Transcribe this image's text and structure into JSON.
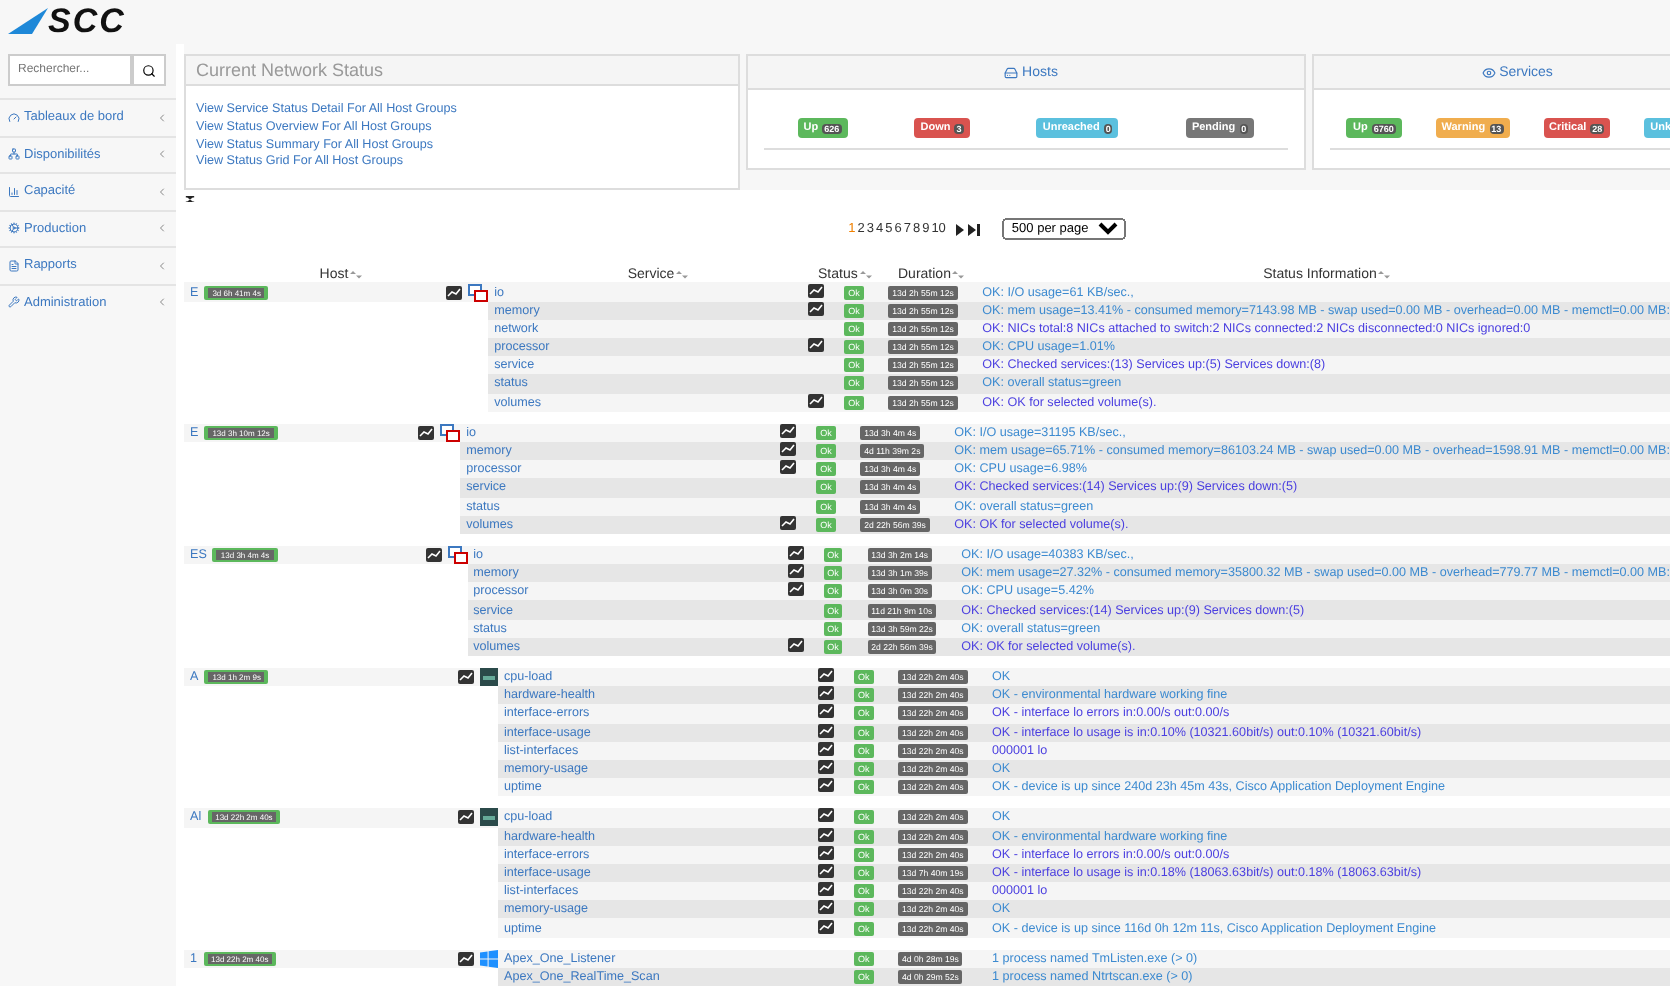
{
  "logo": {
    "text": "SCC"
  },
  "search": {
    "placeholder": "Rechercher..."
  },
  "sidebar": {
    "items": [
      {
        "label": "Tableaux de bord"
      },
      {
        "label": "Disponibilités"
      },
      {
        "label": "Capacité"
      },
      {
        "label": "Production"
      },
      {
        "label": "Rapports"
      },
      {
        "label": "Administration"
      }
    ]
  },
  "network_status": {
    "title": "Current Network Status",
    "links": [
      "View Service Status Detail For All Host Groups",
      "View Status Overview For All Host Groups",
      "View Status Summary For All Host Groups",
      "View Status Grid For All Host Groups"
    ]
  },
  "hosts": {
    "title": "Hosts",
    "badges": [
      {
        "label": "Up",
        "count": "626",
        "color": "#5cb85c"
      },
      {
        "label": "Down",
        "count": "3",
        "color": "#d9534f"
      },
      {
        "label": "Unreached",
        "count": "0",
        "color": "#5bc0de"
      },
      {
        "label": "Pending",
        "count": "0",
        "color": "#777777"
      }
    ]
  },
  "services": {
    "title": "Services",
    "badges": [
      {
        "label": "Up",
        "count": "6760",
        "color": "#5cb85c"
      },
      {
        "label": "Warning",
        "count": "13",
        "color": "#f0ad4e"
      },
      {
        "label": "Critical",
        "count": "28",
        "color": "#d9534f"
      },
      {
        "label": "Unk",
        "color": "#5bc0de"
      }
    ]
  },
  "pagination": {
    "pages": [
      {
        "label": "1",
        "selected": true
      },
      {
        "label": "2",
        "selected": false
      },
      {
        "label": "3",
        "selected": false
      },
      {
        "label": "4",
        "selected": false
      },
      {
        "label": "5",
        "selected": false
      },
      {
        "label": "6",
        "selected": false
      },
      {
        "label": "7",
        "selected": false
      },
      {
        "label": "8",
        "selected": false
      },
      {
        "label": "9",
        "selected": false
      },
      {
        "label": "10",
        "selected": false
      }
    ],
    "per_page": "500 per page"
  },
  "table": {
    "columns": [
      "Host",
      "Service",
      "Status",
      "Duration",
      "Status Information"
    ],
    "groups": [
      {
        "host": "E",
        "host_duration": "3d 6h 41m 4s",
        "kind": "vmware",
        "rows": [
          {
            "service": "io",
            "graph": true,
            "status": "Ok",
            "duration": "13d 2h 55m 12s",
            "info": "OK: I/O usage=61 KB/sec.,",
            "visited": false
          },
          {
            "service": "memory",
            "graph": true,
            "status": "Ok",
            "duration": "13d 2h 55m 12s",
            "info": "OK: mem usage=13.41% - consumed memory=7143.98 MB - swap used=0.00 MB - overhead=0.00 MB - memctl=0.00 MB:",
            "visited": false
          },
          {
            "service": "network",
            "graph": false,
            "status": "Ok",
            "duration": "13d 2h 55m 12s",
            "info": "OK: NICs total:8 NICs attached to switch:2 NICs connected:2 NICs disconnected:0 NICs ignored:0",
            "visited": true
          },
          {
            "service": "processor",
            "graph": true,
            "status": "Ok",
            "duration": "13d 2h 55m 12s",
            "info": "OK: CPU usage=1.01%",
            "visited": false
          },
          {
            "service": "service",
            "graph": false,
            "status": "Ok",
            "duration": "13d 2h 55m 12s",
            "info": "OK: Checked services:(13) Services up:(5) Services down:(8)",
            "visited": true
          },
          {
            "service": "status",
            "graph": false,
            "status": "Ok",
            "duration": "13d 2h 55m 12s",
            "info": "OK: overall status=green",
            "visited": false
          },
          {
            "service": "volumes",
            "graph": true,
            "status": "Ok",
            "duration": "13d 2h 55m 12s",
            "info": "OK: OK for selected volume(s).",
            "visited": true
          }
        ]
      },
      {
        "host": "E",
        "host_duration": "13d 3h 10m 12s",
        "kind": "vmware",
        "rows": [
          {
            "service": "io",
            "graph": true,
            "status": "Ok",
            "duration": "13d 3h 4m 4s",
            "info": "OK: I/O usage=31195 KB/sec.,",
            "visited": false
          },
          {
            "service": "memory",
            "graph": true,
            "status": "Ok",
            "duration": "4d 11h 39m 2s",
            "info": "OK: mem usage=65.71% - consumed memory=86103.24 MB - swap used=0.00 MB - overhead=1598.91 MB - memctl=0.00 MB:",
            "visited": false
          },
          {
            "service": "processor",
            "graph": true,
            "status": "Ok",
            "duration": "13d 3h 4m 4s",
            "info": "OK: CPU usage=6.98%",
            "visited": false
          },
          {
            "service": "service",
            "graph": false,
            "status": "Ok",
            "duration": "13d 3h 4m 4s",
            "info": "OK: Checked services:(14) Services up:(9) Services down:(5)",
            "visited": true
          },
          {
            "service": "status",
            "graph": false,
            "status": "Ok",
            "duration": "13d 3h 4m 4s",
            "info": "OK: overall status=green",
            "visited": false
          },
          {
            "service": "volumes",
            "graph": true,
            "status": "Ok",
            "duration": "2d 22h 56m 39s",
            "info": "OK: OK for selected volume(s).",
            "visited": true
          }
        ]
      },
      {
        "host": "ES",
        "host_duration": "13d 3h 4m 4s",
        "kind": "vmware",
        "rows": [
          {
            "service": "io",
            "graph": true,
            "status": "Ok",
            "duration": "13d 3h 2m 14s",
            "info": "OK: I/O usage=40383 KB/sec.,",
            "visited": false
          },
          {
            "service": "memory",
            "graph": true,
            "status": "Ok",
            "duration": "13d 3h 1m 39s",
            "info": "OK: mem usage=27.32% - consumed memory=35800.32 MB - swap used=0.00 MB - overhead=779.77 MB - memctl=0.00 MB:",
            "visited": false
          },
          {
            "service": "processor",
            "graph": true,
            "status": "Ok",
            "duration": "13d 3h 0m 30s",
            "info": "OK: CPU usage=5.42%",
            "visited": false
          },
          {
            "service": "service",
            "graph": false,
            "status": "Ok",
            "duration": "11d 21h 9m 10s",
            "info": "OK: Checked services:(14) Services up:(9) Services down:(5)",
            "visited": true
          },
          {
            "service": "status",
            "graph": false,
            "status": "Ok",
            "duration": "13d 3h 59m 22s",
            "info": "OK: overall status=green",
            "visited": false
          },
          {
            "service": "volumes",
            "graph": true,
            "status": "Ok",
            "duration": "2d 22h 56m 39s",
            "info": "OK: OK for selected volume(s).",
            "visited": true
          }
        ]
      },
      {
        "host": "A",
        "host_duration": "13d 1h 2m 9s",
        "kind": "cisco",
        "rows": [
          {
            "service": "cpu-load",
            "graph": true,
            "status": "Ok",
            "duration": "13d 22h 2m 40s",
            "info": "OK",
            "visited": false
          },
          {
            "service": "hardware-health",
            "graph": true,
            "status": "Ok",
            "duration": "13d 22h 2m 40s",
            "info": "OK - environmental hardware working fine",
            "visited": false
          },
          {
            "service": "interface-errors",
            "graph": true,
            "status": "Ok",
            "duration": "13d 22h 2m 40s",
            "info": "OK - interface lo errors in:0.00/s out:0.00/s",
            "visited": true
          },
          {
            "service": "interface-usage",
            "graph": true,
            "status": "Ok",
            "duration": "13d 22h 2m 40s",
            "info": "OK - interface lo usage is in:0.10% (10321.60bit/s) out:0.10% (10321.60bit/s)",
            "visited": true
          },
          {
            "service": "list-interfaces",
            "graph": true,
            "status": "Ok",
            "duration": "13d 22h 2m 40s",
            "info": "000001 lo",
            "visited": true
          },
          {
            "service": "memory-usage",
            "graph": true,
            "status": "Ok",
            "duration": "13d 22h 2m 40s",
            "info": "OK",
            "visited": false
          },
          {
            "service": "uptime",
            "graph": true,
            "status": "Ok",
            "duration": "13d 22h 2m 40s",
            "info": "OK - device is up since 240d 23h 45m 43s, Cisco Application Deployment Engine",
            "visited": false
          }
        ]
      },
      {
        "host": "Al",
        "host_duration": "13d 22h 2m 40s",
        "kind": "cisco",
        "rows": [
          {
            "service": "cpu-load",
            "graph": true,
            "status": "Ok",
            "duration": "13d 22h 2m 40s",
            "info": "OK",
            "visited": false
          },
          {
            "service": "hardware-health",
            "graph": true,
            "status": "Ok",
            "duration": "13d 22h 2m 40s",
            "info": "OK - environmental hardware working fine",
            "visited": false
          },
          {
            "service": "interface-errors",
            "graph": true,
            "status": "Ok",
            "duration": "13d 22h 2m 40s",
            "info": "OK - interface lo errors in:0.00/s out:0.00/s",
            "visited": true
          },
          {
            "service": "interface-usage",
            "graph": true,
            "status": "Ok",
            "duration": "13d 7h 40m 19s",
            "info": "OK - interface lo usage is in:0.18% (18063.63bit/s) out:0.18% (18063.63bit/s)",
            "visited": true
          },
          {
            "service": "list-interfaces",
            "graph": true,
            "status": "Ok",
            "duration": "13d 22h 2m 40s",
            "info": "000001 lo",
            "visited": true
          },
          {
            "service": "memory-usage",
            "graph": true,
            "status": "Ok",
            "duration": "13d 22h 2m 40s",
            "info": "OK",
            "visited": false
          },
          {
            "service": "uptime",
            "graph": true,
            "status": "Ok",
            "duration": "13d 22h 2m 40s",
            "info": "OK - device is up since 116d 0h 12m 11s, Cisco Application Deployment Engine",
            "visited": false
          }
        ]
      },
      {
        "host": "1",
        "host_duration": "13d 22h 2m 40s",
        "kind": "windows",
        "rows": [
          {
            "service": "Apex_One_Listener",
            "graph": false,
            "status": "Ok",
            "duration": "4d 0h 28m 19s",
            "info": "1 process named TmListen.exe (> 0)",
            "visited": false
          },
          {
            "service": "Apex_One_RealTime_Scan",
            "graph": false,
            "status": "Ok",
            "duration": "4d 0h 29m 52s",
            "info": "1 process named Ntrtscan.exe (> 0)",
            "visited": false
          }
        ]
      }
    ]
  }
}
